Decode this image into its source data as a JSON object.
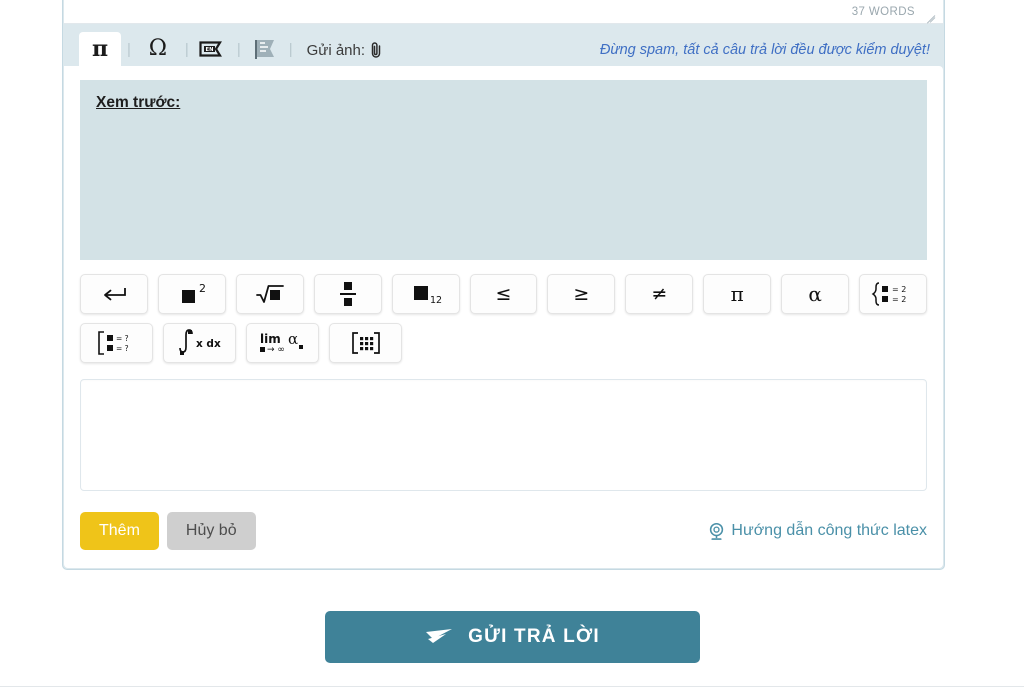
{
  "editor": {
    "word_count": "37 WORDS",
    "resize_handle": "resize-grip"
  },
  "toolbar": {
    "tabs": [
      {
        "name": "math-pi",
        "glyph": "π",
        "active": true
      },
      {
        "name": "special-omega",
        "glyph": "Ω",
        "active": false
      },
      {
        "name": "flag-en",
        "glyph": "EN",
        "active": false
      },
      {
        "name": "flag-vn",
        "glyph": "",
        "active": false
      }
    ],
    "separator": "|",
    "send_image_label": "Gửi ảnh:",
    "attach_icon": "paperclip-icon",
    "spam_note": "Đừng spam, tất cả câu trả lời đều được kiểm duyệt!"
  },
  "preview": {
    "label": "Xem trước:",
    "content": ""
  },
  "symbols": {
    "row1": [
      {
        "name": "newline-button",
        "icon": "newline-arrow",
        "label": "↵"
      },
      {
        "name": "superscript-button",
        "icon": "superscript",
        "label": "■²"
      },
      {
        "name": "sqrt-button",
        "icon": "square-root",
        "label": "√■"
      },
      {
        "name": "fraction-button",
        "icon": "fraction",
        "label": "■/■"
      },
      {
        "name": "subscript-button",
        "icon": "subscript",
        "label": "■₁₂"
      },
      {
        "name": "leq-button",
        "icon": "less-equal",
        "label": "≤"
      },
      {
        "name": "geq-button",
        "icon": "greater-equal",
        "label": "≥"
      },
      {
        "name": "neq-button",
        "icon": "not-equal",
        "label": "≠"
      },
      {
        "name": "pi-button",
        "icon": "pi-symbol",
        "label": "π"
      },
      {
        "name": "alpha-button",
        "icon": "alpha-symbol",
        "label": "α"
      },
      {
        "name": "system-brace-button",
        "icon": "system-of-equations",
        "label": "{■=2 ■=2"
      }
    ],
    "row2": [
      {
        "name": "bracket-system-button",
        "icon": "bracket-system",
        "label": "[■=? ■=?"
      },
      {
        "name": "integral-button",
        "icon": "integral",
        "label": "∫ x dx"
      },
      {
        "name": "limit-button",
        "icon": "limit",
        "label": "lim ■→∞ α"
      },
      {
        "name": "matrix-button",
        "icon": "matrix",
        "label": "[⋮⋮⋮]"
      }
    ]
  },
  "latex_input": {
    "value": "",
    "placeholder": ""
  },
  "actions": {
    "add_label": "Thêm",
    "cancel_label": "Hủy bỏ",
    "help_label": "Hướng dẫn công thức latex",
    "help_icon": "webcam-icon"
  },
  "submit": {
    "label": "GỬI TRẢ LỜI",
    "icon": "paper-plane-icon"
  },
  "colors": {
    "frame_bg": "#dce8ed",
    "preview_bg": "#d3e2e6",
    "accent_blue": "#3f8298",
    "add_yellow": "#efc419",
    "cancel_gray": "#cfcfcf",
    "note_blue": "#3f6fc4",
    "help_teal": "#4a90a8"
  }
}
